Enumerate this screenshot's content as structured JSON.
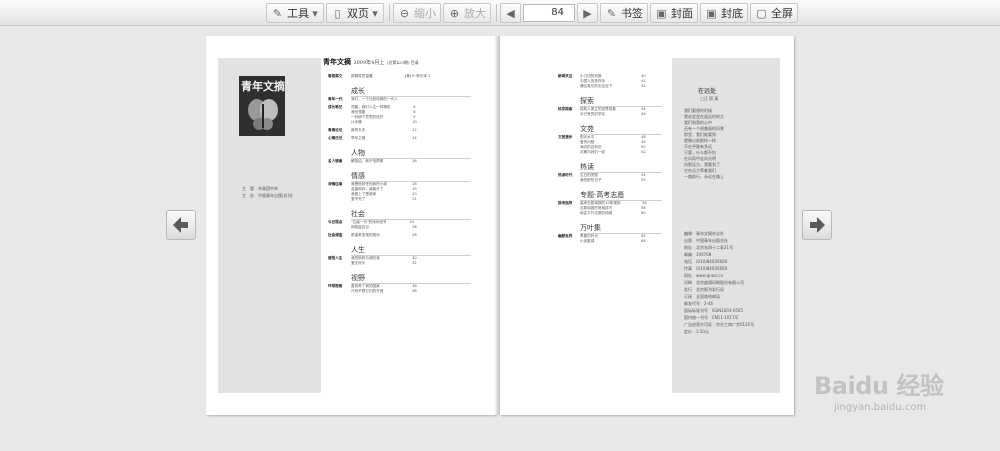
{
  "toolbar": {
    "tools_label": "工具",
    "view_label": "双页",
    "zoom_out_label": "缩小",
    "zoom_in_label": "放大",
    "page_number": "84",
    "bookmark_label": "书签",
    "cover_label": "封面",
    "back_cover_label": "封底",
    "fullscreen_label": "全屏"
  },
  "left_page": {
    "magazine_title": "青年文摘",
    "issue": "2009年4月上",
    "issue_sub": "(总第429期) 目录",
    "cover_title": "青年文摘",
    "publisher_lines": [
      "主　管　共青团中央",
      "主　办　中国青年出版(总)社"
    ],
    "sections": [
      {
        "cat": "卷首美文",
        "heading": "",
        "lines": [
          "那微笑的温暖　　　　　　　　　[美]卡·菲尔泽 1"
        ]
      },
      {
        "cat": "",
        "heading": "成长",
        "lines": []
      },
      {
        "cat": "青年一代",
        "heading": "",
        "lines": [
          "我们，一个比较特殊的一代人"
        ]
      },
      {
        "cat": "成长笔记",
        "heading": "",
        "lines": [
          "同路，我们人生一样精彩　　　　　　 6",
          "我也想要　　　　　　　　　　　　　 8",
          "一封绑个意思的信件　　　　　　　　 9",
          "计步器　　　　　　　　　　　　　　10"
        ]
      },
      {
        "cat": "青春论坛",
        "heading": "",
        "lines": [
          "新的天天　　　　　　　　　　　　　12"
        ]
      },
      {
        "cat": "心情日记",
        "heading": "",
        "lines": [
          "早年之路　　　　　　　　　　　　　14"
        ]
      },
      {
        "cat": "",
        "heading": "人物",
        "lines": []
      },
      {
        "cat": "名人镜像",
        "heading": "",
        "lines": [
          "解放后，我不怕再敬　　　　　　　　16"
        ]
      },
      {
        "cat": "",
        "heading": "情感",
        "lines": []
      },
      {
        "cat": "深情往事",
        "heading": "",
        "lines": [
          "我是他前任的我的小妹　　　　　　　18",
          "孟晶和你，我离开了　　　　　　　　19",
          "我爱上了是谁家　　　　　　　　　　20",
          "爱不完了　　　　　　　　　　　　　21"
        ]
      },
      {
        "cat": "",
        "heading": "社会",
        "lines": []
      },
      {
        "cat": "今日视点",
        "heading": "",
        "lines": [
          "\"五级一代\"的深圳信号　　　　　　 24",
          "网络监控记　　　　　　　　　　　　26"
        ]
      },
      {
        "cat": "社会调查",
        "heading": "",
        "lines": [
          "愿保来发现的规划　　　　　　　　　28"
        ]
      },
      {
        "cat": "",
        "heading": "人生",
        "lines": []
      },
      {
        "cat": "感悟人生",
        "heading": "",
        "lines": [
          "我的妈妈与我的我　　　　　　　　　30",
          "爱无尽头　　　　　　　　　　　　　32"
        ]
      },
      {
        "cat": "",
        "heading": "视野",
        "lines": []
      },
      {
        "cat": "环球视角",
        "heading": "",
        "lines": [
          "善良养了我的国家　　　　　　　　　36",
          "只有不想它们的东西　　　　　　　　38"
        ]
      }
    ]
  },
  "right_page": {
    "sections": [
      {
        "cat": "新闻关注",
        "heading": "",
        "lines": [
          "小刀切的判断　　　　　　　　　　　40",
          "中国人的多样化　　　　　　　　　　41",
          "通往吸引的无论百下　　　　　　　　42"
        ]
      },
      {
        "cat": "",
        "heading": "探索",
        "lines": []
      },
      {
        "cat": "科学探索",
        "heading": "",
        "lines": [
          "探知人类立的世界现象　　　　　　　44",
          "对已有的旧学名　　　　　　　　　　46"
        ]
      },
      {
        "cat": "",
        "heading": "文苑",
        "lines": []
      },
      {
        "cat": "文苑漫步",
        "heading": "",
        "lines": [
          "阳光水平　　　　　　　　　　　　　48",
          "爱的问候　　　　　　　　　　　　　49",
          "海边的自然处　　　　　　　　　　　50",
          "花期与我们一起　　　　　　　　　　52"
        ]
      },
      {
        "cat": "",
        "heading": "热读",
        "lines": []
      },
      {
        "cat": "热读时代",
        "heading": "",
        "lines": [
          "生日的安慰　　　　　　　　　　　　54",
          "我的那些日子　　　　　　　　　　　55"
        ]
      },
      {
        "cat": "",
        "heading": "专题·高考志愿",
        "lines": []
      },
      {
        "cat": "报考指导",
        "heading": "",
        "lines": [
          "高考志愿填报的10条规则　　　　　　56",
          "志愿填报的常用技巧　　　　　　　　58",
          "地区平行志愿的填报　　　　　　　　60"
        ]
      },
      {
        "cat": "",
        "heading": "万叶集",
        "lines": []
      },
      {
        "cat": "幽默世界",
        "heading": "",
        "lines": [
          "青春的时代　　　　　　　　　　　　62",
          "小品集锦　　　　　　　　　　　　　64"
        ]
      }
    ],
    "poem_title": "在远处",
    "poem_author": "□汪 国 真",
    "poem_lines": [
      "我们要想的时候",
      "就必定会在遥远的地方",
      "我们和我的心中",
      "还有一个很美丽的风景",
      "那里，我们能看到",
      "就像以前那样一样",
      "不在乎路有多远",
      "只要，什么都不怕",
      "在风雨中走向光明",
      "向那远方，我看到了",
      "它在远方等着我们",
      "一路前行，永远在路上"
    ],
    "info_lines": [
      "编辑　青年文摘杂志社",
      "出版　中国青年出版总社",
      "地址　北京东四十二条21号",
      "邮编　100708",
      "电话　(010)84035600",
      "传真　(010)84035600",
      "网址　www.qnwz.cn",
      "印刷　北京盛通印刷股份有限公司",
      "发行　北京报刊发行局",
      "订阅　全国各地邮局",
      "邮发代号　2-46",
      "国际标准刊号　ISSN1003-0565",
      "国内统一刊号　CN11-1017/C",
      "广告经营许可证　京东工商广字0121号",
      "定价　3.50元"
    ]
  },
  "watermark": {
    "brand": "Baidu 经验",
    "url": "jingyan.baidu.com"
  }
}
